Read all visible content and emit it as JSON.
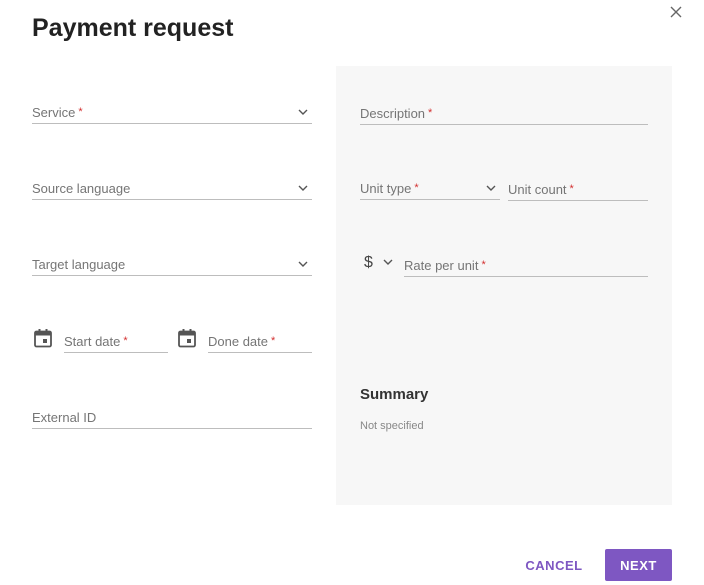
{
  "dialog": {
    "title": "Payment request",
    "close_icon": "close-icon"
  },
  "left": {
    "service": {
      "label": "Service",
      "required": "*"
    },
    "source_language": {
      "label": "Source language"
    },
    "target_language": {
      "label": "Target language"
    },
    "start_date": {
      "label": "Start date",
      "required": "*"
    },
    "done_date": {
      "label": "Done date",
      "required": "*"
    },
    "external_id": {
      "label": "External ID"
    }
  },
  "right": {
    "description": {
      "label": "Description",
      "required": "*"
    },
    "unit_type": {
      "label": "Unit type",
      "required": "*"
    },
    "unit_count": {
      "label": "Unit count",
      "required": "*"
    },
    "currency": "$",
    "rate_per_unit": {
      "label": "Rate per unit",
      "required": "*"
    },
    "summary": {
      "title": "Summary",
      "text": "Not specified"
    }
  },
  "actions": {
    "cancel": "CANCEL",
    "next": "NEXT"
  },
  "colors": {
    "accent": "#7e57c2",
    "required": "#d32f2f",
    "panel_bg": "#f7f7f7"
  }
}
